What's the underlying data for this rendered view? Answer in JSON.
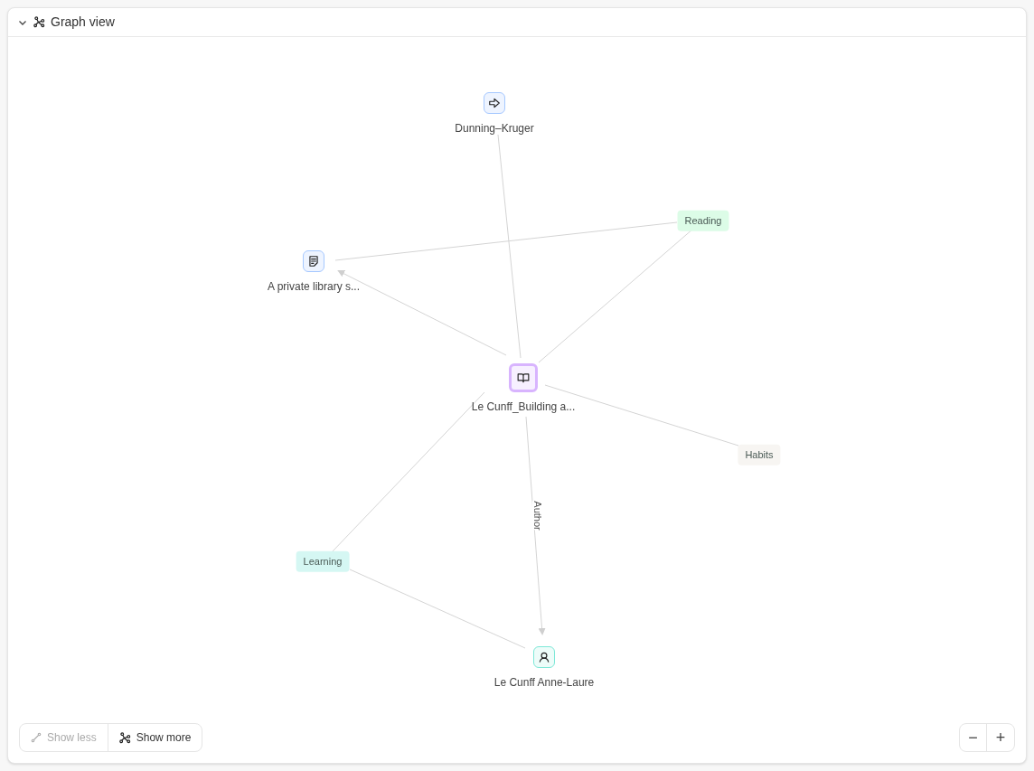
{
  "panel": {
    "title": "Graph view",
    "expanded": true
  },
  "nodes": [
    {
      "kind": "concept",
      "label": "Dunning–Kruger",
      "selected": false
    },
    {
      "kind": "note",
      "label": "A private library s...",
      "selected": false
    },
    {
      "kind": "book",
      "label": "Le Cunff_Building a...",
      "selected": true
    },
    {
      "kind": "person",
      "label": "Le Cunff Anne-Laure",
      "selected": false
    }
  ],
  "tags": [
    {
      "label": "Reading",
      "color": "#dcfce7"
    },
    {
      "label": "Habits",
      "color": "#f7f5f2"
    },
    {
      "label": "Learning",
      "color": "#d5f7f3"
    }
  ],
  "edge_labels": [
    {
      "text": "Author"
    }
  ],
  "controls": {
    "show_less": {
      "label": "Show less",
      "disabled": true
    },
    "show_more": {
      "label": "Show more",
      "disabled": false
    }
  },
  "zoom": {
    "out": "−",
    "in": "+"
  }
}
